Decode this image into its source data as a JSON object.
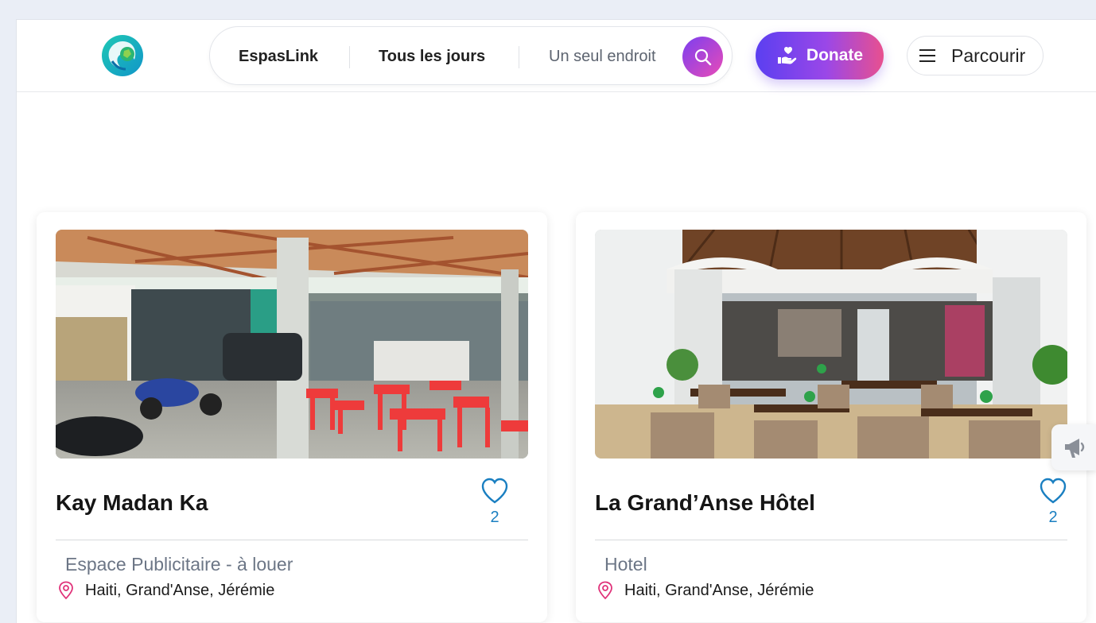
{
  "header": {
    "logo_icon": "globe-leaf-logo-icon",
    "search": {
      "segment_1": "EspasLink",
      "segment_2": "Tous les jours",
      "segment_3": "Un seul endroit",
      "button_icon": "search-icon"
    },
    "donate_label": "Donate",
    "donate_icon": "hand-heart-icon",
    "browse_label": "Parcourir",
    "browse_icon": "menu-icon"
  },
  "listings": [
    {
      "title": "Kay Madan Ka",
      "likes": "2",
      "category": "Espace Publicitaire - à louer",
      "location": "Haiti, Grand'Anse, Jérémie"
    },
    {
      "title": "La Grand’Anse Hôtel",
      "likes": "2",
      "category": "Hotel",
      "location": "Haiti, Grand'Anse, Jérémie"
    }
  ],
  "floating_button_icon": "megaphone-icon",
  "colors": {
    "accent_purple": "#7b3ff0",
    "accent_pink": "#e94bb7",
    "heart_blue": "#1a7fc1",
    "location_pink": "#e0337a",
    "page_background": "#eaeef6"
  }
}
